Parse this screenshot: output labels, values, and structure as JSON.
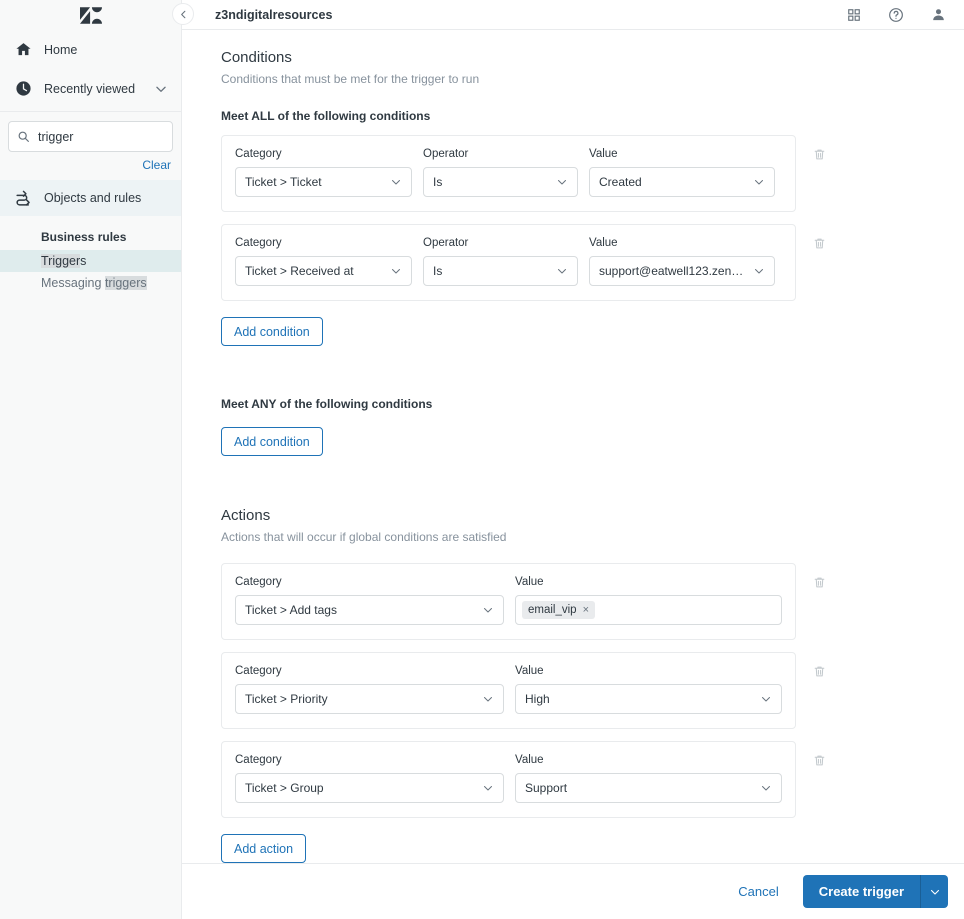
{
  "colors": {
    "accent": "#1f73b7",
    "sidebar_bg": "#f8f9f9",
    "active_item_bg": "#dfeced",
    "objects_rules_bg": "#edf3f5",
    "search_highlight": "#d8dcde",
    "border": "#e9ebed",
    "text": "#2f3941",
    "muted_text": "#87929d"
  },
  "sidebar": {
    "logo": "zendesk-logo",
    "nav": [
      {
        "label": "Home",
        "icon": "home-icon"
      },
      {
        "label": "Recently viewed",
        "icon": "clock-icon",
        "chevron": "chevron-down-icon"
      }
    ],
    "search": {
      "value": "trigger",
      "placeholder": "Search",
      "icon": "search-icon"
    },
    "clear_label": "Clear",
    "objects_and_rules": {
      "label": "Objects and rules",
      "icon": "objects-rules-icon"
    },
    "group_title": "Business rules",
    "sub_items": [
      {
        "label": "Triggers",
        "match": "Trigger",
        "rest": "s",
        "active": true
      },
      {
        "label": "Messaging triggers",
        "prefix": "Messaging ",
        "match": "triggers",
        "active": false
      }
    ]
  },
  "collapse_button": {
    "icon": "chevron-left-icon"
  },
  "topbar": {
    "title": "z3ndigitalresources",
    "icons": [
      {
        "name": "apps-grid-icon"
      },
      {
        "name": "help-circle-icon"
      },
      {
        "name": "user-avatar-icon"
      }
    ]
  },
  "conditions": {
    "title": "Conditions",
    "subtitle": "Conditions that must be met for the trigger to run",
    "all_label": "Meet ALL of the following conditions",
    "any_label": "Meet ANY of the following conditions",
    "labels": {
      "category": "Category",
      "operator": "Operator",
      "value": "Value"
    },
    "all_rows": [
      {
        "category": "Ticket > Ticket",
        "operator": "Is",
        "value": "Created"
      },
      {
        "category": "Ticket > Received at",
        "operator": "Is",
        "value": "support@eatwell123.zendes..."
      }
    ],
    "any_rows": [],
    "add_condition_label": "Add condition",
    "add_condition_any_label": "Add condition"
  },
  "actions": {
    "title": "Actions",
    "subtitle": "Actions that will occur if global conditions are satisfied",
    "labels": {
      "category": "Category",
      "value": "Value"
    },
    "rows": [
      {
        "category": "Ticket > Add tags",
        "value_type": "tags",
        "tags": [
          {
            "label": "email_vip",
            "remove": "×"
          }
        ]
      },
      {
        "category": "Ticket > Priority",
        "value_type": "select",
        "value": "High"
      },
      {
        "category": "Ticket > Group",
        "value_type": "select",
        "value": "Support"
      }
    ],
    "add_action_label": "Add action"
  },
  "footer": {
    "cancel_label": "Cancel",
    "create_label": "Create trigger",
    "dropdown_icon": "chevron-down-icon"
  }
}
